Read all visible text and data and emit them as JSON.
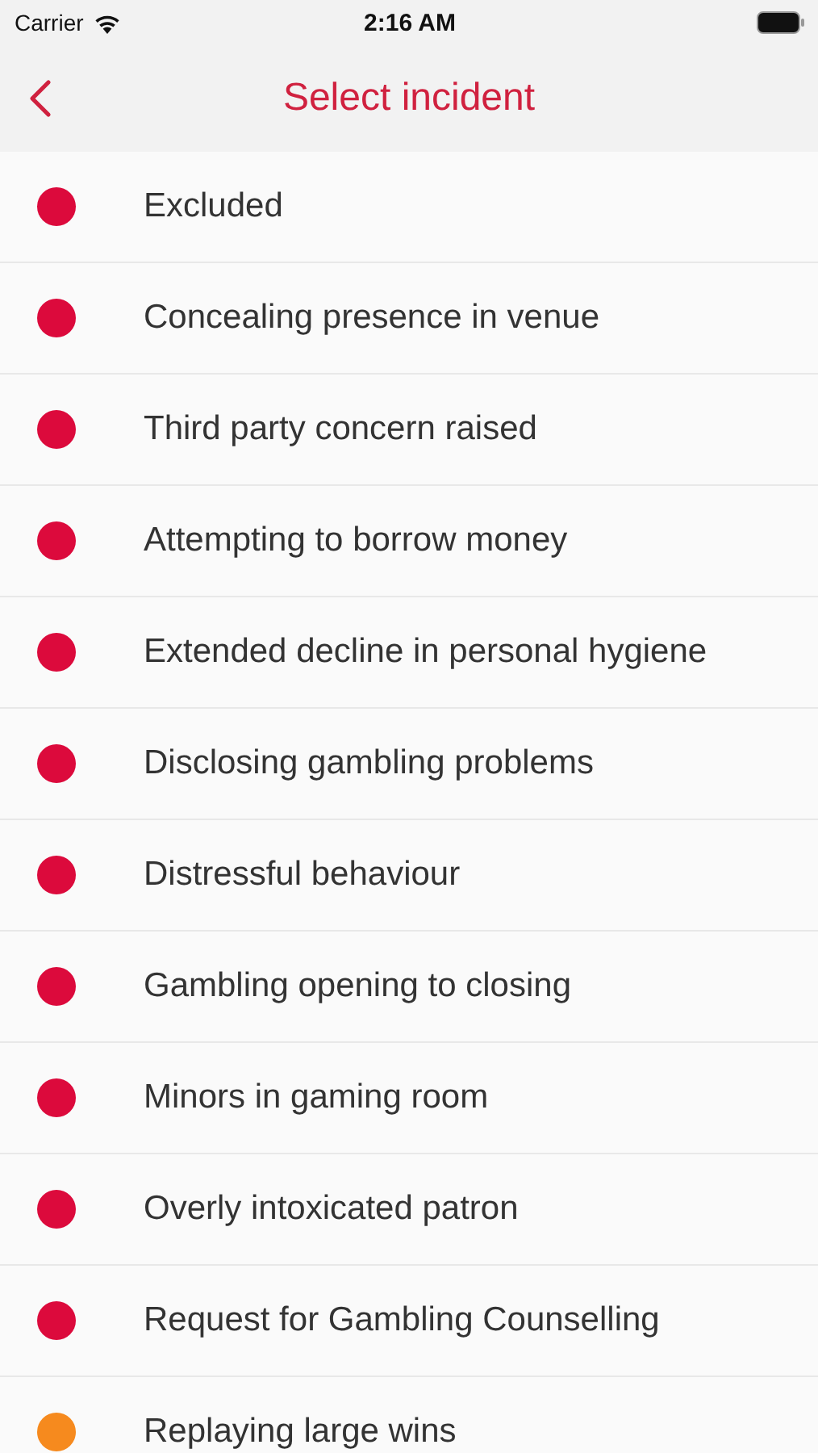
{
  "status_bar": {
    "carrier": "Carrier",
    "time": "2:16 AM"
  },
  "nav_bar": {
    "title": "Select incident"
  },
  "incidents": [
    {
      "label": "Excluded",
      "color": "#dc0a3c"
    },
    {
      "label": "Concealing presence in venue",
      "color": "#dc0a3c"
    },
    {
      "label": "Third party concern raised",
      "color": "#dc0a3c"
    },
    {
      "label": "Attempting to borrow money",
      "color": "#dc0a3c"
    },
    {
      "label": "Extended decline in personal hygiene",
      "color": "#dc0a3c"
    },
    {
      "label": "Disclosing gambling problems",
      "color": "#dc0a3c"
    },
    {
      "label": "Distressful behaviour",
      "color": "#dc0a3c"
    },
    {
      "label": "Gambling opening to closing",
      "color": "#dc0a3c"
    },
    {
      "label": "Minors in gaming room",
      "color": "#dc0a3c"
    },
    {
      "label": "Overly intoxicated patron",
      "color": "#dc0a3c"
    },
    {
      "label": "Request for Gambling Counselling",
      "color": "#dc0a3c"
    },
    {
      "label": "Replaying large wins",
      "color": "#f68a1e"
    }
  ]
}
